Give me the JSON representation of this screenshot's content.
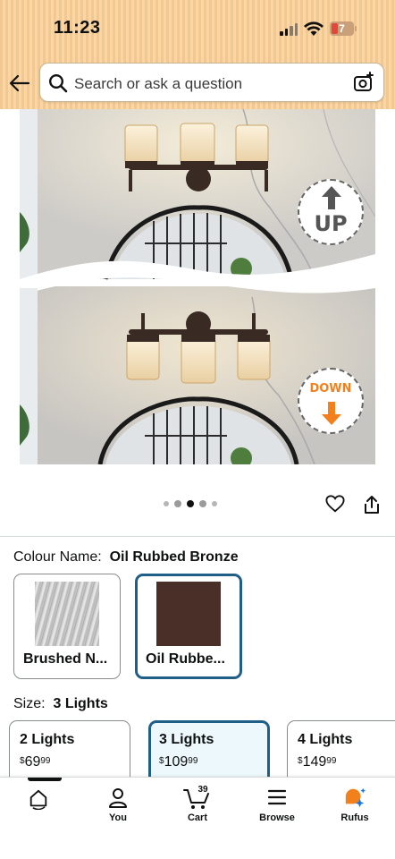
{
  "status": {
    "time": "11:23",
    "battery": "7",
    "battery_level": 0.07
  },
  "search": {
    "placeholder": "Search or ask a question"
  },
  "gallery": {
    "badge_up": "UP",
    "badge_down": "DOWN",
    "dot_count": 5,
    "active_dot": 2
  },
  "colour": {
    "label": "Colour Name:",
    "selected": "Oil Rubbed Bronze",
    "options": [
      {
        "name": "Brushed N...",
        "swatch": "#c0c0c0"
      },
      {
        "name": "Oil Rubbe...",
        "swatch": "#4a2f28"
      }
    ]
  },
  "size": {
    "label": "Size:",
    "selected": "3 Lights",
    "options": [
      {
        "name": "2 Lights",
        "currency": "$",
        "whole": "69",
        "cents": "99"
      },
      {
        "name": "3 Lights",
        "currency": "$",
        "whole": "109",
        "cents": "99"
      },
      {
        "name": "4 Lights",
        "currency": "$",
        "whole": "149",
        "cents": "99"
      }
    ]
  },
  "nav": {
    "items": [
      {
        "label": "",
        "icon": "home-icon"
      },
      {
        "label": "You",
        "icon": "person-icon"
      },
      {
        "label": "Cart",
        "icon": "cart-icon",
        "count": "39"
      },
      {
        "label": "Browse",
        "icon": "menu-icon"
      },
      {
        "label": "Rufus",
        "icon": "rufus-icon"
      }
    ]
  },
  "colors": {
    "header": "#f3c890",
    "selected_border": "#1f5f87",
    "selected_bg": "#edf8fd",
    "down_accent": "#f2801c"
  }
}
